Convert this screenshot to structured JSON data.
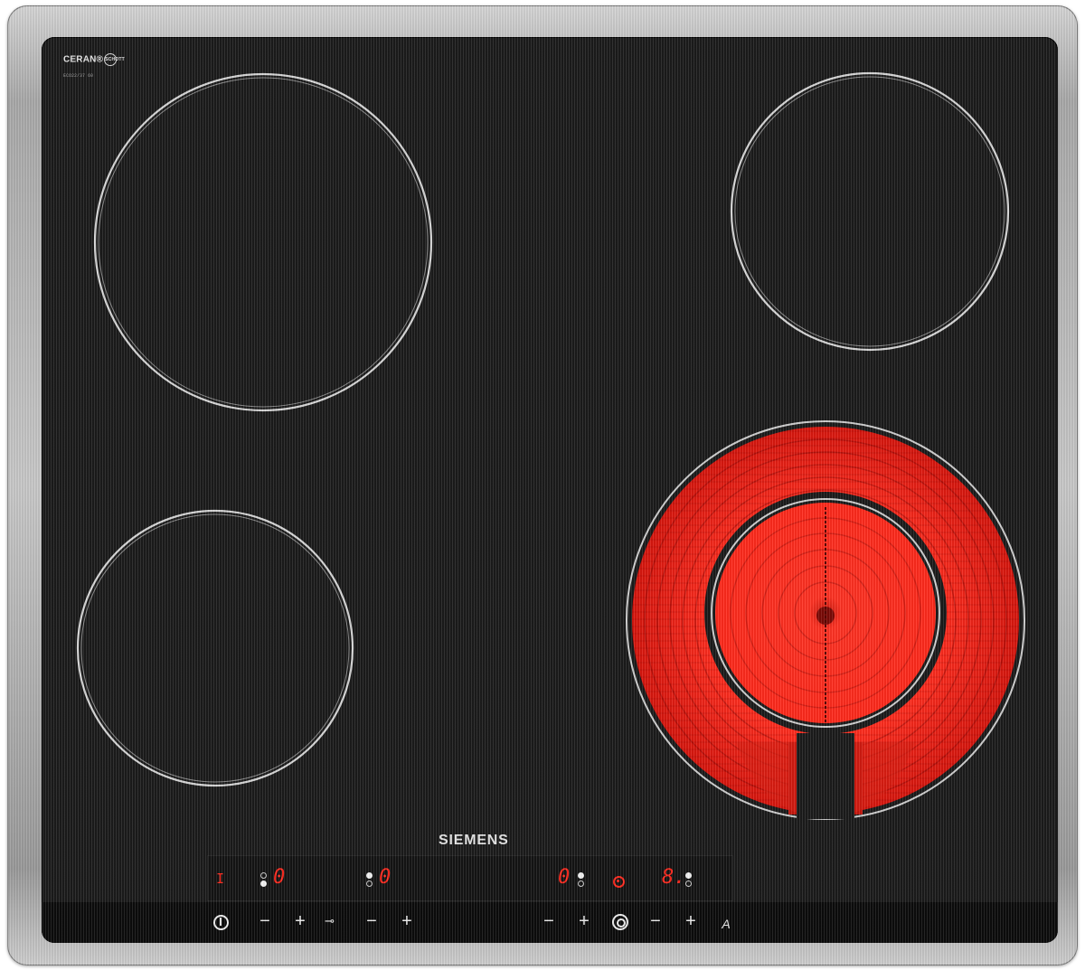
{
  "cooktop": {
    "logo_text": "CERAN®",
    "logo_mark_text": "SCHOTT",
    "model_text": "ECO22/37 60",
    "brand": "SIEMENS",
    "colors": {
      "frame": "#b4b4b4",
      "glass": "#1b1b1b",
      "heat": "#ff2a1f",
      "ring": "#d8d8d8"
    },
    "zones": [
      {
        "name": "rear-left",
        "state": "off"
      },
      {
        "name": "rear-right",
        "state": "off"
      },
      {
        "name": "front-left",
        "state": "off"
      },
      {
        "name": "front-right",
        "state": "heating",
        "dual_circuit": true
      }
    ],
    "display": {
      "power_indicator": "I",
      "zone1_level": "0",
      "zone2_level": "0",
      "zone3_level": "0",
      "zone4_level": "8."
    },
    "controls": {
      "minus": "−",
      "plus": "+",
      "lock_icon": "child-lock-key-icon",
      "power_icon": "power-icon",
      "dual_zone_icon": "dual-zone-icon",
      "auto_label": "A"
    }
  }
}
